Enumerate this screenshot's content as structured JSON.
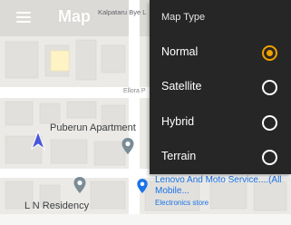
{
  "app_bar": {
    "title": "Map",
    "menu_icon": "hamburger-menu-icon"
  },
  "map": {
    "street_labels": [
      "Kalpataru Bye L",
      "Ellora P"
    ],
    "places": [
      {
        "name": "Puberun Apartment",
        "icon": "place-pin-icon"
      },
      {
        "name": "L N Residency",
        "icon": "place-pin-icon"
      },
      {
        "name": "Lenovo And Moto Service....(All Mobile...",
        "category": "Electronics store",
        "icon": "place-pin-icon"
      }
    ],
    "location_icon": "navigation-arrow-icon"
  },
  "map_type_panel": {
    "title": "Map Type",
    "options": [
      {
        "label": "Normal",
        "selected": true
      },
      {
        "label": "Satellite",
        "selected": false
      },
      {
        "label": "Hybrid",
        "selected": false
      },
      {
        "label": "Terrain",
        "selected": false
      }
    ]
  },
  "colors": {
    "panel_bg": "#262626",
    "accent": "#f0a000",
    "poi_blue": "#1a73e8",
    "poi_gray": "#5f6368"
  }
}
